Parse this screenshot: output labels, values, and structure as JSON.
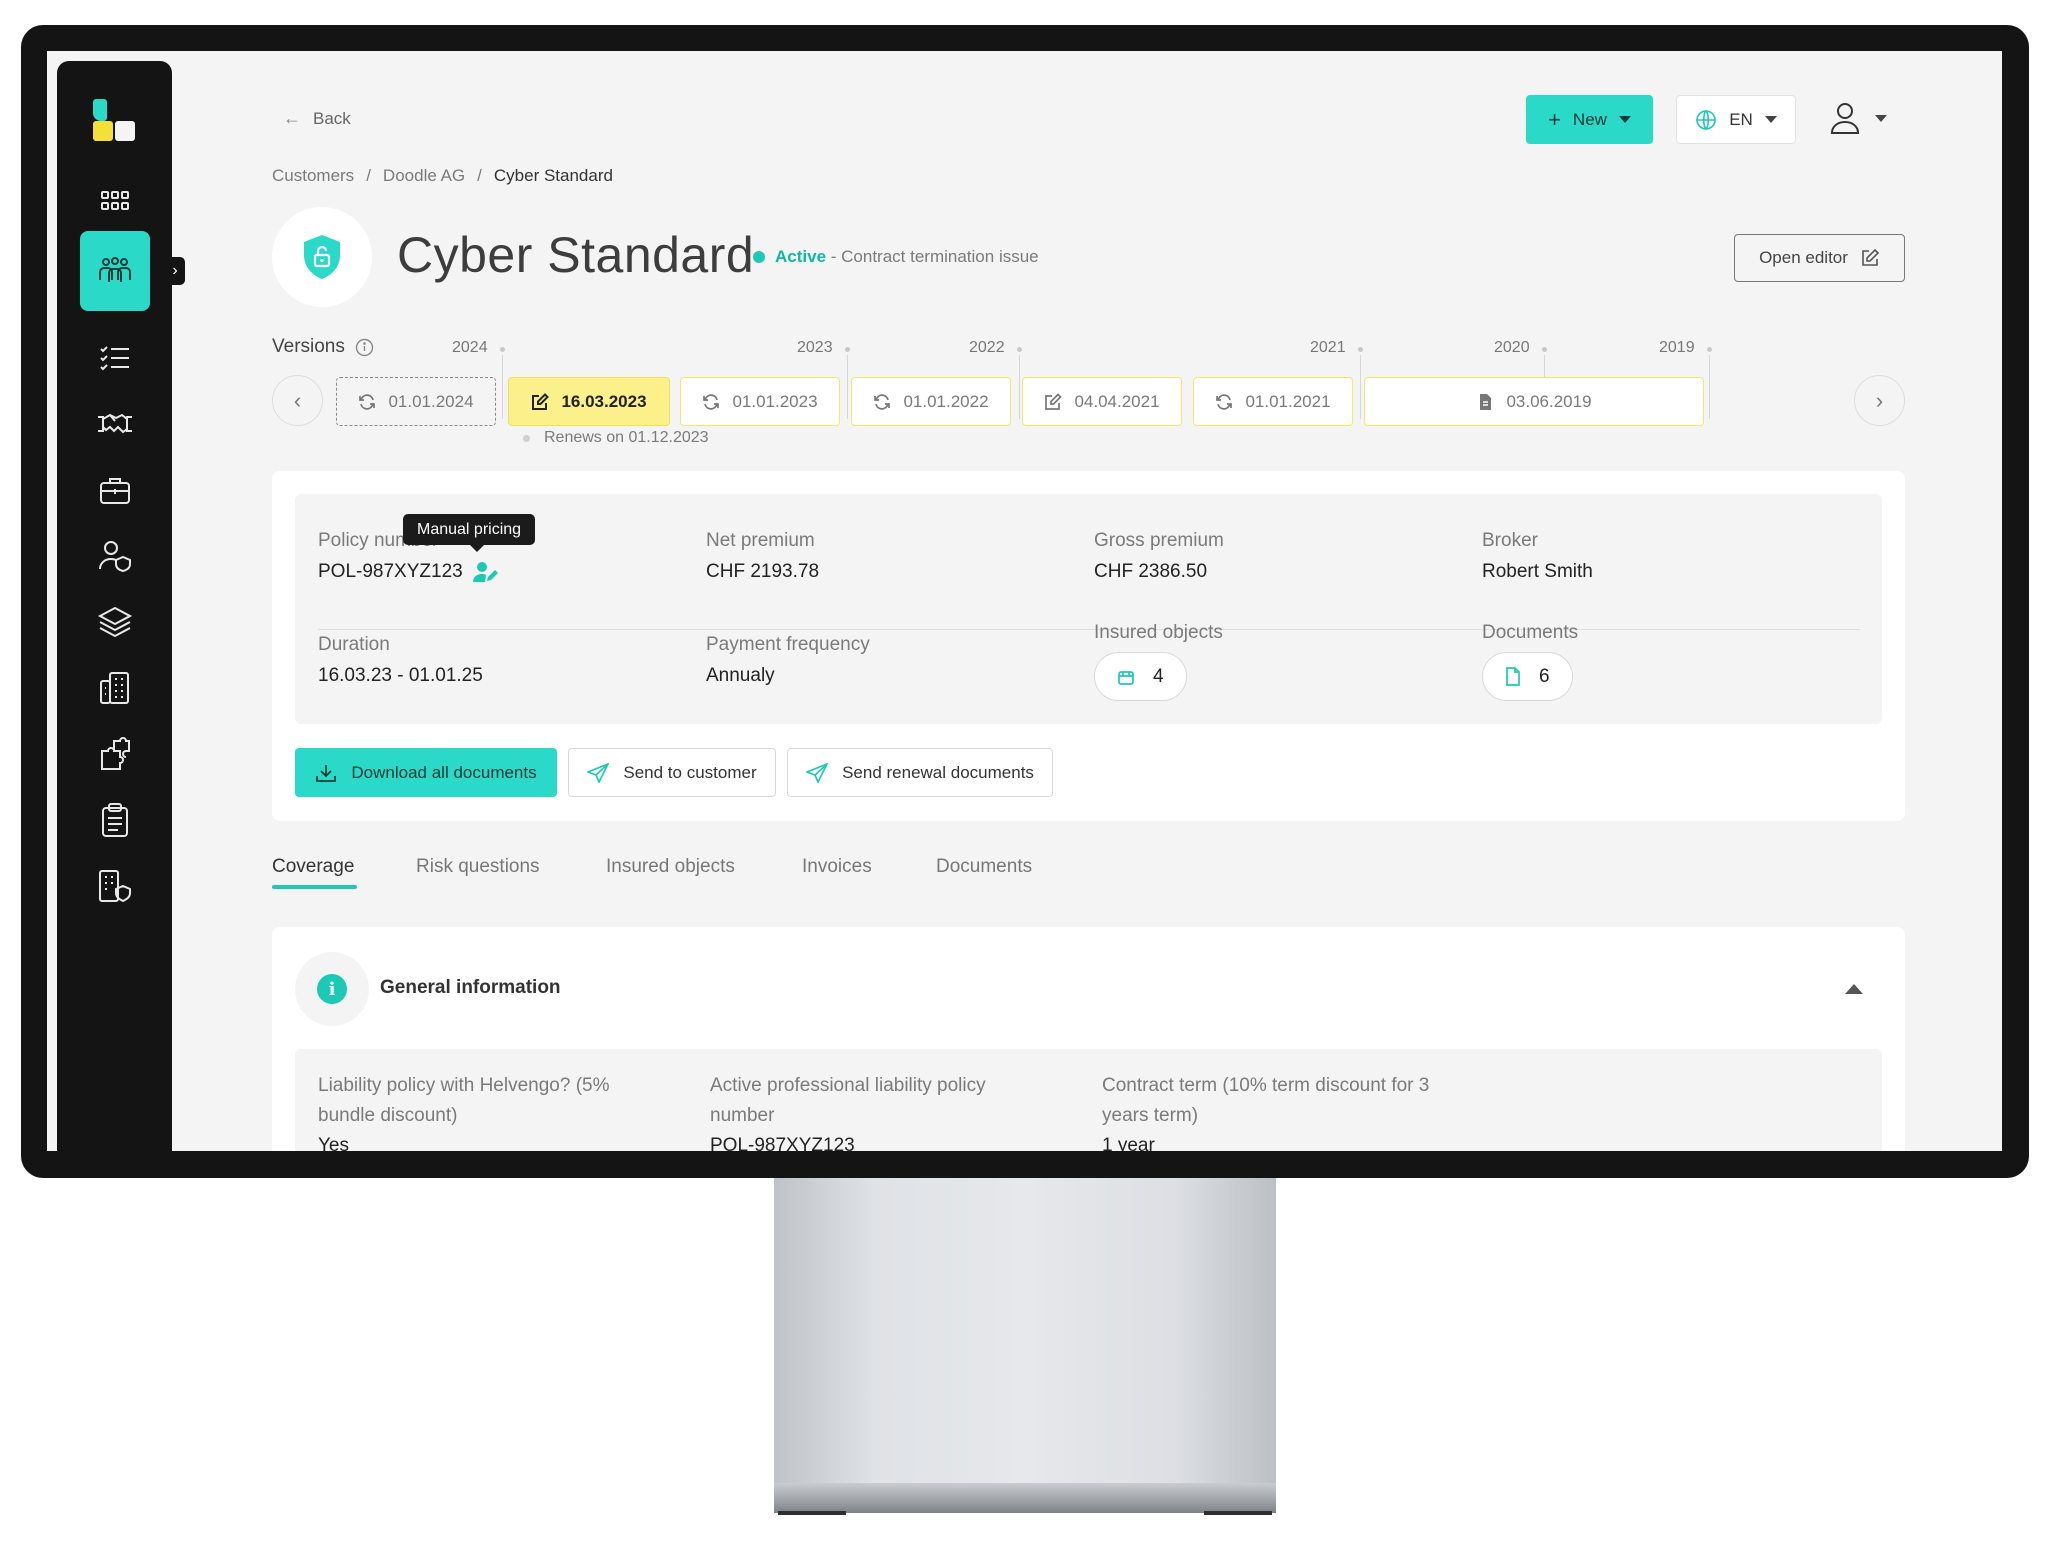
{
  "header": {
    "back_label": "Back",
    "new_label": "New",
    "language": "EN",
    "open_editor_label": "Open editor"
  },
  "breadcrumb": [
    "Customers",
    "Doodle AG",
    "Cyber Standard"
  ],
  "policy": {
    "title": "Cyber Standard",
    "status": "Active",
    "status_note": "- Contract termination issue"
  },
  "versions": {
    "label": "Versions",
    "years": [
      "2024",
      "2023",
      "2022",
      "2021",
      "2020",
      "2019"
    ],
    "items": [
      {
        "date": "01.01.2024",
        "icon": "refresh-icon"
      },
      {
        "date": "16.03.2023",
        "icon": "edit-icon"
      },
      {
        "date": "01.01.2023",
        "icon": "refresh-icon"
      },
      {
        "date": "01.01.2022",
        "icon": "refresh-icon"
      },
      {
        "date": "04.04.2021",
        "icon": "edit-icon"
      },
      {
        "date": "01.01.2021",
        "icon": "refresh-icon"
      },
      {
        "date": "03.06.2019",
        "icon": "document-icon"
      }
    ],
    "renews_note": "Renews on 01.12.2023"
  },
  "summary": {
    "tooltip": "Manual pricing",
    "policy_number_label": "Policy number",
    "policy_number": "POL-987XYZ123",
    "net_premium_label": "Net premium",
    "net_premium": "CHF 2193.78",
    "gross_premium_label": "Gross premium",
    "gross_premium": "CHF 2386.50",
    "broker_label": "Broker",
    "broker": "Robert Smith",
    "duration_label": "Duration",
    "duration": "16.03.23 - 01.01.25",
    "payment_frequency_label": "Payment frequency",
    "payment_frequency": "Annualy",
    "insured_objects_label": "Insured objects",
    "insured_objects_count": "4",
    "documents_label": "Documents",
    "documents_count": "6"
  },
  "actions": {
    "download_all": "Download all documents",
    "send_to_customer": "Send to customer",
    "send_renewal": "Send renewal documents"
  },
  "tabs": [
    "Coverage",
    "Risk questions",
    "Insured objects",
    "Invoices",
    "Documents"
  ],
  "general_info": {
    "title": "General information",
    "questions": [
      {
        "q": "Liability policy with Helvengo? (5% bundle discount)",
        "a": "Yes"
      },
      {
        "q": "Active professional liability policy number",
        "a": "POL-987XYZ123"
      },
      {
        "q": "Contract term (10% term discount for 3 years term)",
        "a": "1 year"
      }
    ]
  },
  "colors": {
    "accent": "#2bd9c8",
    "sidebar": "#141414",
    "current_version": "#fbf08a",
    "status_active": "#10b8a4"
  }
}
